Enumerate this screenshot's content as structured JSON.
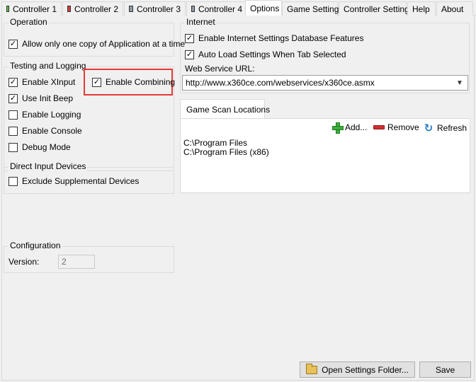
{
  "tabs": [
    {
      "label": "Controller 1",
      "icon": "controller-green-icon"
    },
    {
      "label": "Controller 2",
      "icon": "controller-red-icon"
    },
    {
      "label": "Controller 3",
      "icon": "controller-gray-icon"
    },
    {
      "label": "Controller 4",
      "icon": "controller-gray-icon"
    },
    {
      "label": "Options",
      "active": true
    },
    {
      "label": "Game Settings"
    },
    {
      "label": "Controller Settings"
    },
    {
      "label": "Help"
    },
    {
      "label": "About"
    }
  ],
  "operation": {
    "legend": "Operation",
    "allow_one_copy": {
      "label": "Allow only one copy of Application at a time",
      "checked": true
    }
  },
  "testing": {
    "legend": "Testing and Logging",
    "enable_xinput": {
      "label": "Enable XInput",
      "checked": true
    },
    "enable_combining": {
      "label": "Enable Combining",
      "checked": true
    },
    "use_init_beep": {
      "label": "Use Init Beep",
      "checked": true
    },
    "enable_logging": {
      "label": "Enable Logging",
      "checked": false
    },
    "enable_console": {
      "label": "Enable Console",
      "checked": false
    },
    "debug_mode": {
      "label": "Debug Mode",
      "checked": false
    }
  },
  "direct_input": {
    "legend": "Direct Input Devices",
    "exclude_supplemental": {
      "label": "Exclude Supplemental Devices",
      "checked": false
    }
  },
  "configuration": {
    "legend": "Configuration",
    "version_label": "Version:",
    "version_value": "2"
  },
  "internet": {
    "legend": "Internet",
    "enable_db": {
      "label": "Enable Internet Settings Database Features",
      "checked": true
    },
    "auto_load": {
      "label": "Auto Load Settings When Tab Selected",
      "checked": true
    },
    "web_service_label": "Web Service URL:",
    "web_service_url": "http://www.x360ce.com/webservices/x360ce.asmx"
  },
  "game_scan": {
    "tab_label": "Game Scan Locations",
    "add_label": "Add...",
    "remove_label": "Remove",
    "refresh_label": "Refresh",
    "locations": [
      "C:\\Program Files",
      "C:\\Program Files (x86)"
    ]
  },
  "footer": {
    "open_settings_label": "Open Settings Folder...",
    "save_label": "Save"
  },
  "colors": {
    "highlight": "#e53935"
  }
}
